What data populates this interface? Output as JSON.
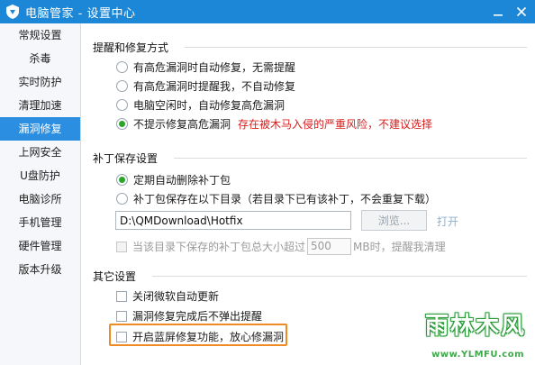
{
  "window": {
    "title": "电脑管家 - 设置中心",
    "logo_icon": "shield-icon",
    "titlebar_color": "#1b87d6"
  },
  "sidebar": {
    "items": [
      {
        "label": "常规设置",
        "active": false
      },
      {
        "label": "杀毒",
        "active": false
      },
      {
        "label": "实时防护",
        "active": false
      },
      {
        "label": "清理加速",
        "active": false
      },
      {
        "label": "漏洞修复",
        "active": true
      },
      {
        "label": "上网安全",
        "active": false
      },
      {
        "label": "U盘防护",
        "active": false
      },
      {
        "label": "电脑诊所",
        "active": false
      },
      {
        "label": "手机管理",
        "active": false
      },
      {
        "label": "硬件管理",
        "active": false
      },
      {
        "label": "版本升级",
        "active": false
      }
    ],
    "active_color": "#2b8ee0"
  },
  "repair_mode": {
    "title": "提醒和修复方式",
    "options": [
      {
        "label": "有高危漏洞时自动修复，无需提醒",
        "checked": false
      },
      {
        "label": "有高危漏洞时提醒我，不自动修复",
        "checked": false
      },
      {
        "label": "电脑空闲时，自动修复高危漏洞",
        "checked": false
      },
      {
        "label": "不提示修复高危漏洞",
        "checked": true,
        "warning": "存在被木马入侵的严重风险，不建议选择"
      }
    ],
    "warning_color": "#d91c1c"
  },
  "patch_save": {
    "title": "补丁保存设置",
    "options": [
      {
        "label": "定期自动删除补丁包",
        "checked": true
      },
      {
        "label": "补丁包保存在以下目录（若目录下已有该补丁，不会重复下载）",
        "checked": false
      }
    ],
    "path_value": "D:\\QMDownload\\Hotfix",
    "browse_label": "浏览...",
    "open_label": "打开",
    "size_limit": {
      "prefix": "当该目录下保存的补丁包总大小超过",
      "value": "500",
      "suffix": "MB时，提醒我清理"
    }
  },
  "other": {
    "title": "其它设置",
    "options": [
      {
        "label": "关闭微软自动更新",
        "checked": false
      },
      {
        "label": "漏洞修复完成后不弹出提醒",
        "checked": false
      },
      {
        "label": "开启蓝屏修复功能，放心修漏洞",
        "checked": false,
        "highlighted": true
      }
    ],
    "highlight_color": "#f08a25"
  },
  "watermark": {
    "main": "雨林木风",
    "url": "www.YLMFU.com"
  }
}
